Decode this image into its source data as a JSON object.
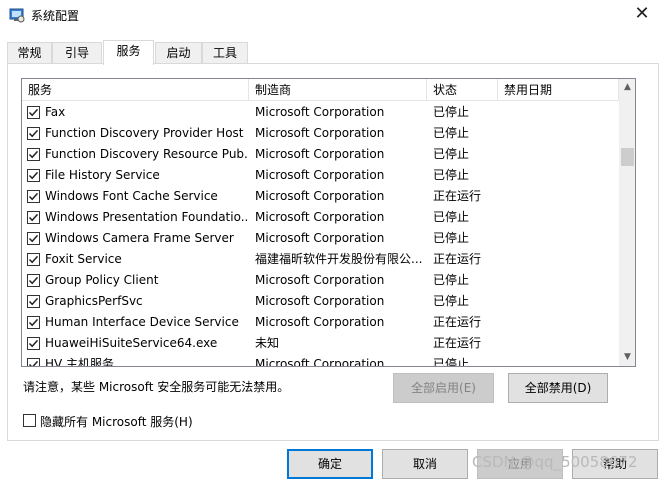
{
  "window": {
    "title": "系统配置"
  },
  "tabs": [
    {
      "label": "常规"
    },
    {
      "label": "引导"
    },
    {
      "label": "服务"
    },
    {
      "label": "启动"
    },
    {
      "label": "工具"
    }
  ],
  "table": {
    "columns": [
      "服务",
      "制造商",
      "状态",
      "禁用日期"
    ],
    "rows": [
      {
        "service": "Fax",
        "maker": "Microsoft Corporation",
        "status": "已停止",
        "date": ""
      },
      {
        "service": "Function Discovery Provider Host",
        "maker": "Microsoft Corporation",
        "status": "已停止",
        "date": ""
      },
      {
        "service": "Function Discovery Resource Pub...",
        "maker": "Microsoft Corporation",
        "status": "已停止",
        "date": ""
      },
      {
        "service": "File History Service",
        "maker": "Microsoft Corporation",
        "status": "已停止",
        "date": ""
      },
      {
        "service": "Windows Font Cache Service",
        "maker": "Microsoft Corporation",
        "status": "正在运行",
        "date": ""
      },
      {
        "service": "Windows Presentation Foundatio...",
        "maker": "Microsoft Corporation",
        "status": "已停止",
        "date": ""
      },
      {
        "service": "Windows Camera Frame Server",
        "maker": "Microsoft Corporation",
        "status": "已停止",
        "date": ""
      },
      {
        "service": "Foxit Service",
        "maker": "福建福昕软件开发股份有限公...",
        "status": "正在运行",
        "date": ""
      },
      {
        "service": "Group Policy Client",
        "maker": "Microsoft Corporation",
        "status": "已停止",
        "date": ""
      },
      {
        "service": "GraphicsPerfSvc",
        "maker": "Microsoft Corporation",
        "status": "已停止",
        "date": ""
      },
      {
        "service": "Human Interface Device Service",
        "maker": "Microsoft Corporation",
        "status": "正在运行",
        "date": ""
      },
      {
        "service": "HuaweiHiSuiteService64.exe",
        "maker": "未知",
        "status": "正在运行",
        "date": ""
      },
      {
        "service": "HV 主机服务",
        "maker": "Microsoft Corporation",
        "status": "已停止",
        "date": ""
      }
    ]
  },
  "notice": "请注意，某些 Microsoft 安全服务可能无法禁用。",
  "buttons": {
    "enable_all": "全部启用(E)",
    "disable_all": "全部禁用(D)",
    "ok": "确定",
    "cancel": "取消",
    "apply": "应用",
    "help": "帮助"
  },
  "hide_ms_label": "隐藏所有 Microsoft 服务(H)",
  "watermark": "CSDN @qq_50058672",
  "icons": {
    "app": "system-config-icon",
    "close": "close-icon",
    "check": "checkmark-icon",
    "scroll_up": "chevron-up-icon",
    "scroll_down": "chevron-down-icon"
  }
}
